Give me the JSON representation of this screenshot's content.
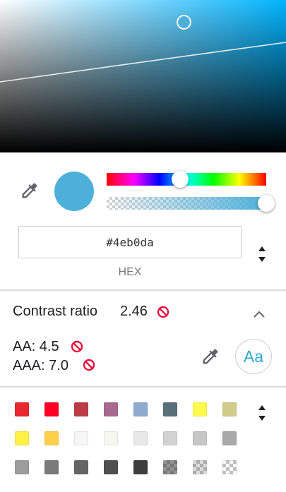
{
  "picker": {
    "current_color": "#4eb0da",
    "hue_position": 0.46,
    "alpha_position": 1.0
  },
  "hex": {
    "value": "#4eb0da",
    "format_label": "HEX"
  },
  "contrast": {
    "title": "Contrast ratio",
    "ratio": "2.46",
    "aa_label": "AA: 4.5",
    "aaa_label": "AAA: 7.0",
    "preview_text": "Aa",
    "fail_color": "#e8113e"
  },
  "icons": {
    "eyedropper": "eyedropper-icon",
    "fail": "no-entry-icon",
    "collapse": "chevron-up-icon",
    "toggle": "up-down-arrows-icon"
  },
  "palette": {
    "rows": [
      [
        {
          "color": "#e8282e"
        },
        {
          "color": "#ff0022"
        },
        {
          "color": "#bb3c45"
        },
        {
          "color": "#a8698f"
        },
        {
          "color": "#8eabcf"
        },
        {
          "color": "#57707a"
        },
        {
          "color": "#fffb4a"
        },
        {
          "color": "#d2cc8a"
        }
      ],
      [
        {
          "color": "#fff046"
        },
        {
          "color": "#ffcf4a"
        },
        {
          "color": "#f6f6f6"
        },
        {
          "color": "#f6f7ee"
        },
        {
          "color": "#e8e8e8"
        },
        {
          "color": "#d2d2d2"
        },
        {
          "color": "#c6c6c6"
        },
        {
          "color": "#a9a9a9"
        }
      ],
      [
        {
          "color": "#9c9c9c"
        },
        {
          "color": "#7a7a7a"
        },
        {
          "color": "#656565"
        },
        {
          "color": "#4f4f4f"
        },
        {
          "color": "#3e3e3e"
        },
        {
          "color": "rgba(60,60,60,0.55)",
          "checker": true
        },
        {
          "color": "rgba(120,120,120,0.25)",
          "checker": true
        },
        {
          "color": "rgba(200,200,200,0.15)",
          "checker": true
        }
      ]
    ]
  }
}
